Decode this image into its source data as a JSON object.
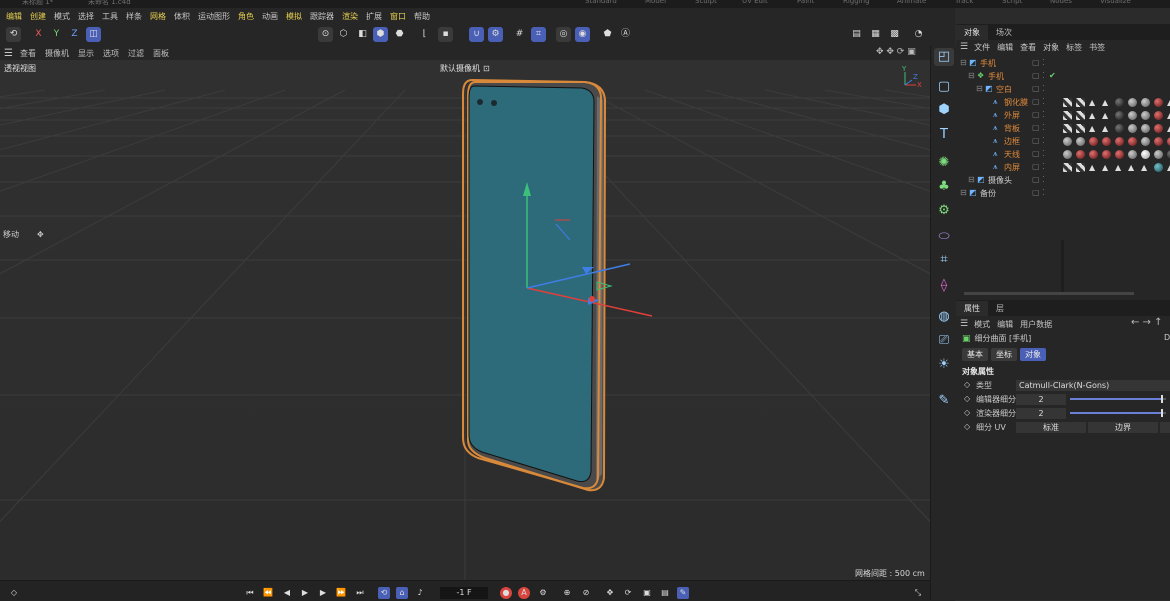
{
  "topbar": {
    "tabs": [
      "未标题 1*",
      "未命名 1.c4d",
      "Standard",
      "Model",
      "Sculpt",
      "UV Edit",
      "Paint",
      "Rigging",
      "Animate",
      "Track",
      "Script",
      "Nodes",
      "Visualize"
    ]
  },
  "menubar": {
    "items": [
      {
        "label": "编辑",
        "hl": true
      },
      {
        "label": "创建",
        "hl": true
      },
      {
        "label": "模式",
        "hl": false
      },
      {
        "label": "选择",
        "hl": false
      },
      {
        "label": "工具",
        "hl": false
      },
      {
        "label": "样条",
        "hl": false
      },
      {
        "label": "网格",
        "hl": true
      },
      {
        "label": "体积",
        "hl": false
      },
      {
        "label": "运动图形",
        "hl": false
      },
      {
        "label": "角色",
        "hl": true
      },
      {
        "label": "动画",
        "hl": false
      },
      {
        "label": "模拟",
        "hl": true
      },
      {
        "label": "跟踪器",
        "hl": false
      },
      {
        "label": "渲染",
        "hl": true
      },
      {
        "label": "扩展",
        "hl": false
      },
      {
        "label": "窗口",
        "hl": true
      },
      {
        "label": "帮助",
        "hl": false
      }
    ]
  },
  "toolbar": {
    "axis_x": "X",
    "axis_y": "Y",
    "axis_z": "Z"
  },
  "viewport_menu": {
    "items": [
      "查看",
      "摄像机",
      "显示",
      "选项",
      "过滤",
      "面板"
    ]
  },
  "viewport": {
    "name": "透视视图",
    "camera": "默认摄像机",
    "camera_icon": "camera-icon",
    "tool": "移动",
    "grid_spacing": "网格间距 : 500 cm",
    "axis_colors": {
      "x": "#e0403a",
      "y": "#3dc07a",
      "z": "#3f7ee6"
    },
    "phone_screen_color": "#2d6a7a",
    "phone_frame_color": "#d9893a"
  },
  "bottombar": {
    "frame": "-1 F"
  },
  "object_panel": {
    "tabs": [
      "对象",
      "场次"
    ],
    "menu": [
      "文件",
      "编辑",
      "查看",
      "对象",
      "标签",
      "书签"
    ],
    "objects": [
      {
        "name": "手机",
        "level": 0,
        "icon": "layer-icon",
        "white": false,
        "check": false,
        "tags": []
      },
      {
        "name": "手机",
        "level": 1,
        "icon": "subdivision-icon",
        "white": false,
        "check": true,
        "tags": []
      },
      {
        "name": "空白",
        "level": 2,
        "icon": "null-icon",
        "white": false,
        "check": false,
        "tags": []
      },
      {
        "name": "钢化膜",
        "level": 3,
        "icon": "polygon-icon",
        "white": false,
        "check": false,
        "tags": [
          "checker",
          "checker",
          "tri",
          "tri",
          "ball-dark",
          "ball-glass",
          "ball-glass",
          "ball-red",
          "tri"
        ]
      },
      {
        "name": "外屏",
        "level": 3,
        "icon": "polygon-icon",
        "white": false,
        "check": false,
        "tags": [
          "checker",
          "checker",
          "tri",
          "tri",
          "ball-dark",
          "ball-glass",
          "ball-glass",
          "ball-red",
          "tri"
        ]
      },
      {
        "name": "背板",
        "level": 3,
        "icon": "polygon-icon",
        "white": false,
        "check": false,
        "tags": [
          "checker",
          "checker",
          "tri",
          "tri",
          "ball-dark",
          "ball-glass",
          "ball-glass",
          "ball-red",
          "tri"
        ]
      },
      {
        "name": "边框",
        "level": 3,
        "icon": "polygon-icon",
        "white": false,
        "check": false,
        "tags": [
          "ball-glass",
          "ball-glass",
          "ball-red",
          "ball-red",
          "ball-red",
          "ball-red",
          "ball-glass",
          "ball-red",
          "ball-red"
        ]
      },
      {
        "name": "天线",
        "level": 3,
        "icon": "polygon-icon",
        "white": false,
        "check": false,
        "tags": [
          "ball-glass",
          "ball-red",
          "ball-red",
          "ball-red",
          "ball-red",
          "ball-glass",
          "ball-white",
          "ball-glass",
          "ball-dark"
        ]
      },
      {
        "name": "内屏",
        "level": 3,
        "icon": "polygon-icon",
        "white": false,
        "check": false,
        "tags": [
          "checker",
          "checker",
          "tri",
          "tri",
          "tri",
          "tri",
          "tri",
          "ball-teal",
          "tri"
        ]
      },
      {
        "name": "摄像头",
        "level": 1,
        "icon": "layer-icon",
        "white": true,
        "check": false,
        "tags": []
      },
      {
        "name": "备份",
        "level": 0,
        "icon": "layer-icon",
        "white": true,
        "check": false,
        "tags": []
      }
    ]
  },
  "attr_panel": {
    "tabs": [
      "属性",
      "层"
    ],
    "menu": [
      "模式",
      "编辑",
      "用户数据"
    ],
    "object_title": "细分曲面 [手机]",
    "subtabs": [
      {
        "label": "基本",
        "active": false
      },
      {
        "label": "坐标",
        "active": false
      },
      {
        "label": "对象",
        "active": true
      }
    ],
    "section": "对象属性",
    "props": [
      {
        "label": "类型",
        "value": "Catmull-Clark(N-Gons)",
        "slider": null
      },
      {
        "label": "编辑器细分",
        "value": "2",
        "slider": 0.95
      },
      {
        "label": "渲染器细分",
        "value": "2",
        "slider": 0.95
      }
    ],
    "uv_label": "细分 UV",
    "uv_options": [
      "标准",
      "边界"
    ]
  }
}
